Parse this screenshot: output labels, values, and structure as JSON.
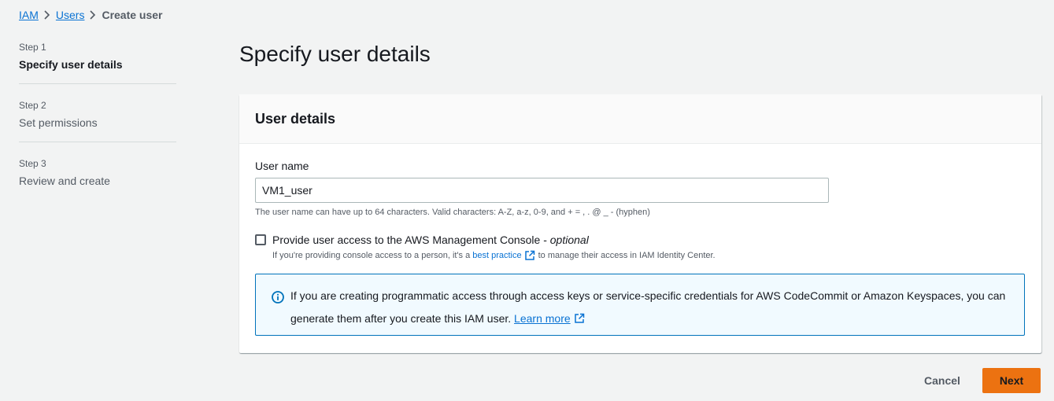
{
  "breadcrumb": {
    "items": [
      "IAM",
      "Users"
    ],
    "current": "Create user"
  },
  "steps": [
    {
      "number": "Step 1",
      "title": "Specify user details",
      "active": true
    },
    {
      "number": "Step 2",
      "title": "Set permissions",
      "active": false
    },
    {
      "number": "Step 3",
      "title": "Review and create",
      "active": false
    }
  ],
  "page": {
    "title": "Specify user details"
  },
  "panel": {
    "title": "User details",
    "username": {
      "label": "User name",
      "value": "VM1_user",
      "hint": "The user name can have up to 64 characters. Valid characters: A-Z, a-z, 0-9, and + = , . @ _ - (hyphen)"
    },
    "console_access": {
      "label": "Provide user access to the AWS Management Console - ",
      "label_optional": "optional",
      "checked": false,
      "desc_before": "If you're providing console access to a person, it's a",
      "desc_link": "best practice",
      "desc_after": "to manage their access in IAM Identity Center."
    },
    "info": {
      "text": "If you are creating programmatic access through access keys or service-specific credentials for AWS CodeCommit or Amazon Keyspaces, you can generate them after you create this IAM user.",
      "link": "Learn more"
    }
  },
  "actions": {
    "cancel": "Cancel",
    "next": "Next"
  },
  "colors": {
    "accent": "#ec7211",
    "link": "#0972d3",
    "info_border": "#0073bb"
  },
  "icons": [
    "chevron-right-icon",
    "external-link-icon",
    "info-icon"
  ]
}
